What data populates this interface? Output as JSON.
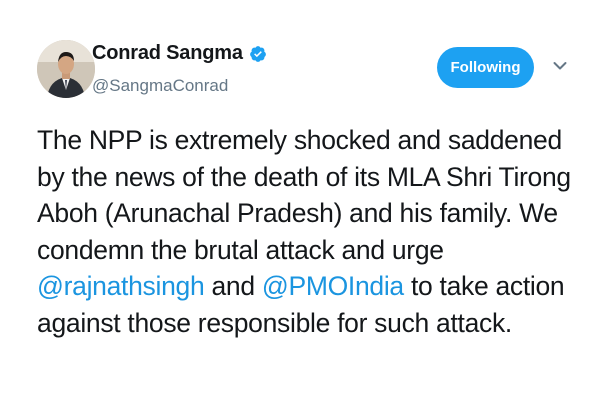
{
  "user": {
    "display_name": "Conrad Sangma",
    "handle": "@SangmaConrad",
    "verified_icon": "verified-badge-icon"
  },
  "follow_button": {
    "label": "Following"
  },
  "menu": {
    "icon": "chevron-down-icon"
  },
  "tweet": {
    "text_part_1": "The NPP is extremely shocked and saddened by the news of the death of its MLA Shri Tirong Aboh (Arunachal Pradesh) and his family. We condemn the brutal attack and urge ",
    "mention_1": "@rajnathsingh",
    "text_part_2": " and ",
    "mention_2": "@PMOIndia",
    "text_part_3": " to take action against those responsible for such attack."
  },
  "colors": {
    "accent": "#1da1f2",
    "link": "#1b95e0",
    "secondary_text": "#657786",
    "primary_text": "#14171a"
  }
}
